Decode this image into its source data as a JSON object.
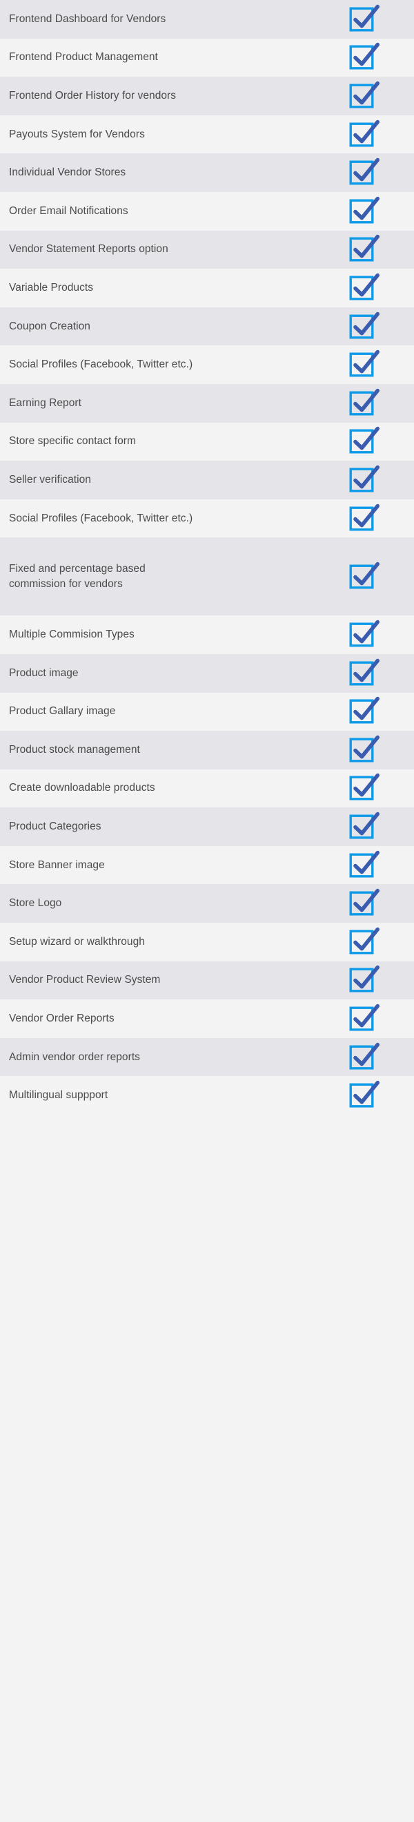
{
  "page": {
    "type": "feature-checklist-table",
    "total_rows": 27,
    "all_checked": true
  },
  "colors": {
    "row_background_odd": "#e5e4e8",
    "row_background_even": "#f3f3f3",
    "label_text": "#4a4a4a",
    "checkbox_border": "#0d9ae8",
    "checkmark": "#3a5cae"
  },
  "checkbox": {
    "icon_name": "checked-checkbox-icon",
    "state": "checked",
    "aria_label": "Included"
  },
  "rows": [
    {
      "label": "Frontend Dashboard for Vendors",
      "checked": true
    },
    {
      "label": "Frontend Product Management",
      "checked": true
    },
    {
      "label": "Frontend Order History for vendors",
      "checked": true
    },
    {
      "label": "Payouts System for Vendors",
      "checked": true
    },
    {
      "label": "Individual Vendor Stores",
      "checked": true
    },
    {
      "label": "Order Email Notifications",
      "checked": true
    },
    {
      "label": "Vendor Statement Reports option",
      "checked": true
    },
    {
      "label": "Variable Products",
      "checked": true
    },
    {
      "label": "Coupon Creation",
      "checked": true
    },
    {
      "label": "Social Profiles (Facebook, Twitter etc.)",
      "checked": true
    },
    {
      "label": "Earning Report",
      "checked": true
    },
    {
      "label": "Store specific contact form",
      "checked": true
    },
    {
      "label": "Seller verification",
      "checked": true
    },
    {
      "label": "Social Profiles (Facebook, Twitter etc.)",
      "checked": true
    },
    {
      "label": "Fixed and percentage based\ncommission for vendors",
      "checked": true,
      "tall": true
    },
    {
      "label": "Multiple Commision Types",
      "checked": true
    },
    {
      "label": "Product image",
      "checked": true
    },
    {
      "label": "Product Gallary image",
      "checked": true
    },
    {
      "label": "Product stock management",
      "checked": true
    },
    {
      "label": "Create downloadable products",
      "checked": true
    },
    {
      "label": "Product Categories",
      "checked": true
    },
    {
      "label": "Store Banner image",
      "checked": true
    },
    {
      "label": "Store Logo",
      "checked": true
    },
    {
      "label": "Setup wizard or walkthrough",
      "checked": true
    },
    {
      "label": "Vendor Product Review System",
      "checked": true
    },
    {
      "label": "Vendor Order Reports",
      "checked": true
    },
    {
      "label": "Admin vendor order reports",
      "checked": true
    },
    {
      "label": "Multilingual suppport",
      "checked": true
    }
  ]
}
